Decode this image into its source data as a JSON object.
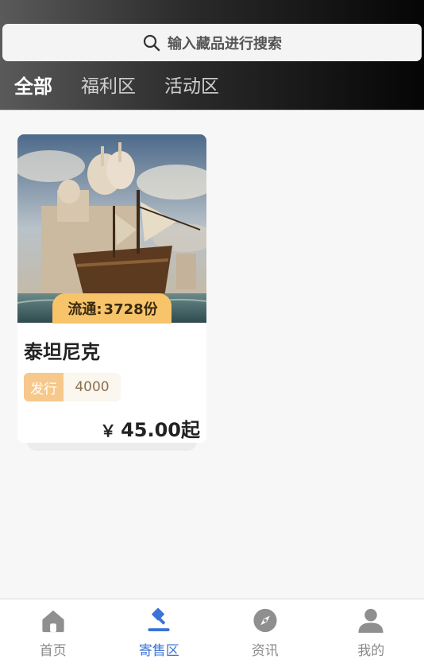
{
  "search": {
    "placeholder": "输入藏品进行搜索"
  },
  "tabs": [
    {
      "label": "全部",
      "active": true
    },
    {
      "label": "福利区",
      "active": false
    },
    {
      "label": "活动区",
      "active": false
    }
  ],
  "product": {
    "circulation_label": "流通:",
    "circulation_value": "3728份",
    "title": "泰坦尼克",
    "issue_label": "发行",
    "issue_value": "4000",
    "currency": "￥",
    "price": "45.00起"
  },
  "bottom_nav": [
    {
      "label": "首页",
      "icon": "home-icon",
      "active": false
    },
    {
      "label": "寄售区",
      "icon": "gavel-icon",
      "active": true
    },
    {
      "label": "资讯",
      "icon": "compass-icon",
      "active": false
    },
    {
      "label": "我的",
      "icon": "user-icon",
      "active": false
    }
  ],
  "colors": {
    "accent": "#3b73d6",
    "badge": "#f7c46a",
    "issue_label_bg": "#f7c88b",
    "inactive_nav": "#8a8a8a"
  }
}
